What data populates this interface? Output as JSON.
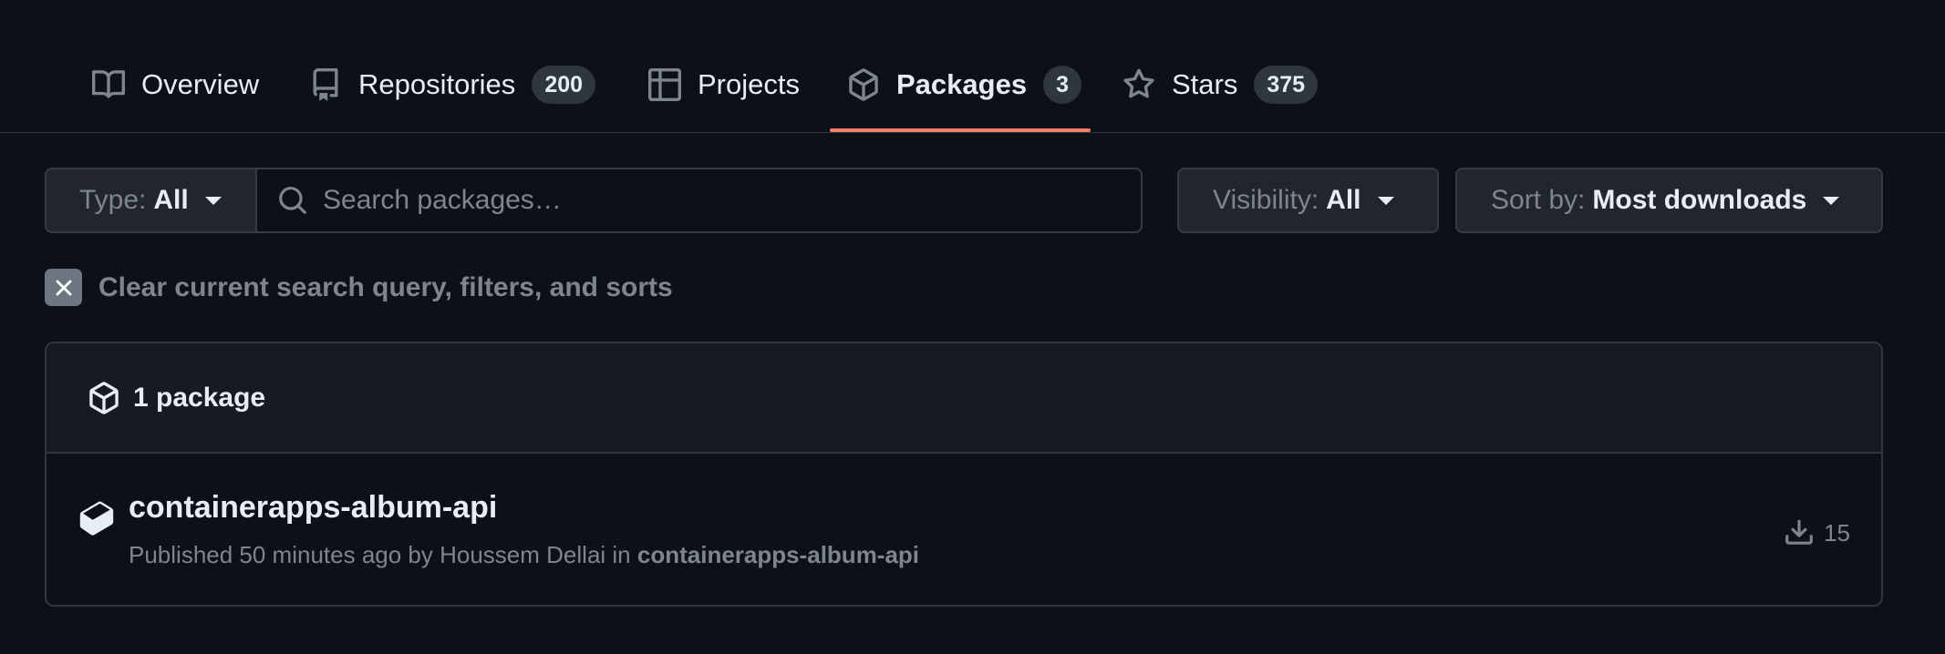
{
  "tabs": [
    {
      "label": "Overview",
      "icon": "book-icon"
    },
    {
      "label": "Repositories",
      "counter": "200",
      "icon": "repo-icon"
    },
    {
      "label": "Projects",
      "icon": "table-icon"
    },
    {
      "label": "Packages",
      "counter": "3",
      "icon": "package-icon",
      "selected": true
    },
    {
      "label": "Stars",
      "counter": "375",
      "icon": "star-icon"
    }
  ],
  "filters": {
    "type_prefix": "Type:",
    "type_value": "All",
    "search_placeholder": "Search packages…",
    "visibility_prefix": "Visibility:",
    "visibility_value": "All",
    "sort_prefix": "Sort by:",
    "sort_value": "Most downloads"
  },
  "clear_filters_label": "Clear current search query, filters, and sorts",
  "results": {
    "count_label": "1 package",
    "packages": [
      {
        "name": "containerapps-album-api",
        "published_prefix": "Published 50 minutes ago by Houssem Dellai in",
        "repository": "containerapps-album-api",
        "downloads": "15"
      }
    ]
  },
  "colors": {
    "background": "#0d1117",
    "accent_underline": "#f78166",
    "muted_text": "#7d8590"
  }
}
